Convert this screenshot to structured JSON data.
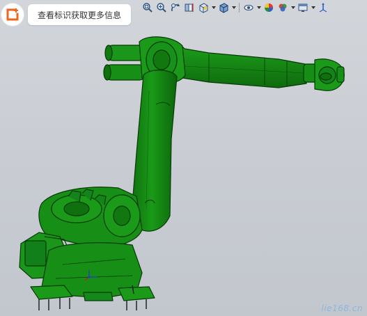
{
  "hint": {
    "text": "查看标识获取更多信息"
  },
  "toolbar": {
    "tools": [
      {
        "icon": "zoom-to-fit-icon"
      },
      {
        "icon": "zoom-to-area-icon"
      },
      {
        "icon": "previous-view-icon"
      },
      {
        "icon": "section-view-icon"
      },
      {
        "icon": "view-orientation-icon"
      },
      {
        "icon": "display-style-icon"
      },
      {
        "icon": "hide-show-items-icon"
      },
      {
        "icon": "edit-appearance-icon"
      },
      {
        "icon": "apply-scene-icon"
      },
      {
        "icon": "view-settings-icon"
      },
      {
        "icon": "triad-icon"
      }
    ]
  },
  "model": {
    "color": "#178c16",
    "edge_color": "#053a05"
  },
  "watermark": {
    "text": "lie168.cn"
  }
}
